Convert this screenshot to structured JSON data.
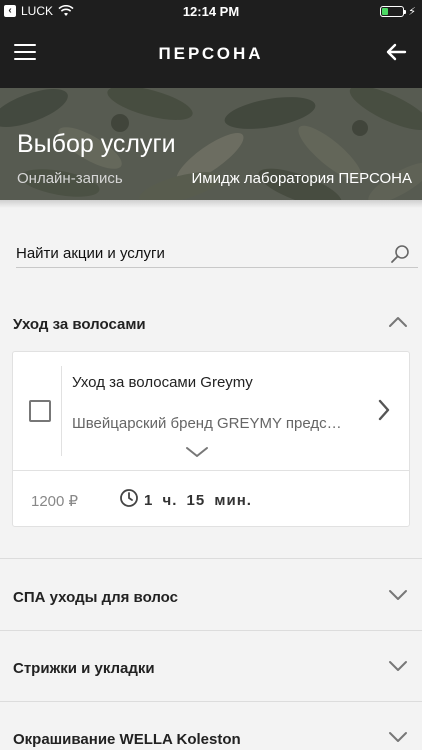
{
  "status_bar": {
    "back_app": "LUCK",
    "time": "12:14 PM",
    "battery_level": 0.3
  },
  "nav": {
    "logo": "ПЕРСОНА",
    "menu_icon": "hamburger-icon",
    "back_icon": "arrow-left-icon"
  },
  "hero": {
    "title": "Выбор услуги",
    "subtitle": "Онлайн-запись",
    "salon": "Имидж лаборатория ПЕРСОНА"
  },
  "search": {
    "placeholder": "Найти акции и услуги",
    "icon": "search-icon"
  },
  "categories": [
    {
      "label": "Уход за волосами",
      "expanded": true,
      "services": [
        {
          "name": "Уход за волосами Greymy",
          "description": "Швейцарский бренд GREYMY предс…",
          "price": "1200 ₽",
          "duration": "1 ч. 15 мин.",
          "checked": false
        }
      ]
    },
    {
      "label": "СПА уходы для волос",
      "expanded": false
    },
    {
      "label": "Стрижки и укладки",
      "expanded": false
    },
    {
      "label": "Окрашивание WELLA Koleston",
      "expanded": false
    }
  ],
  "colors": {
    "bar_bg": "#1e1e1e",
    "page_bg": "#f3f3f3",
    "battery_fill": "#4cd964"
  }
}
